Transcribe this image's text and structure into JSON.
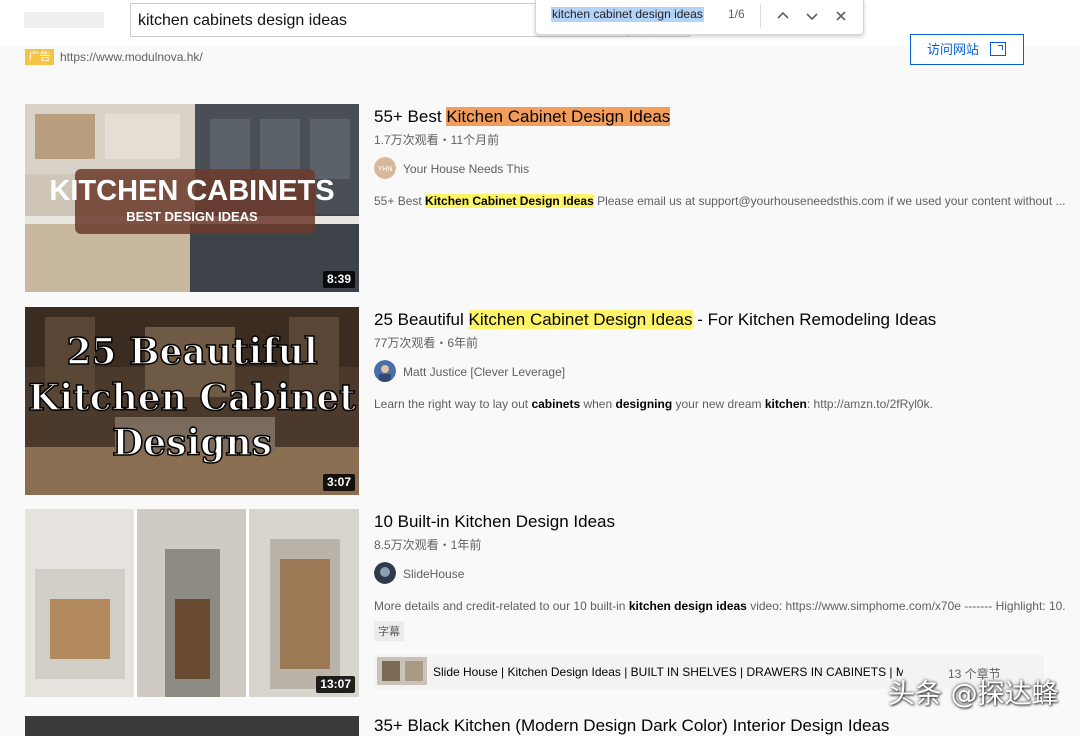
{
  "search": {
    "query": "kitchen cabinets design ideas"
  },
  "find_bar": {
    "query": "kitchen cabinet design ideas",
    "count": "1/6",
    "icons": [
      "chevron-up-icon",
      "chevron-down-icon",
      "close-icon"
    ]
  },
  "ad": {
    "badge": "广告",
    "url": "https://www.modulnova.hk/",
    "visit_label": "访问网站"
  },
  "videos": [
    {
      "title_prefix": "55+ Best ",
      "title_highlight": "Kitchen Cabinet Design Ideas",
      "title_suffix": "",
      "meta": "1.7万次观看・11个月前",
      "channel": "Your House Needs This",
      "avatar_text": "YHN",
      "desc_prefix": "55+ Best ",
      "desc_highlight": "Kitchen Cabinet Design Ideas",
      "desc_suffix": " Please email us at support@yourhouseneedsthis.com if we used your content without ...",
      "thumb_line1": "KITCHEN CABINETS",
      "thumb_line2": "BEST DESIGN IDEAS",
      "duration": "8:39"
    },
    {
      "title_prefix": "25 Beautiful ",
      "title_highlight": "Kitchen Cabinet Design Ideas",
      "title_suffix": " - For Kitchen Remodeling Ideas",
      "meta": "77万次观看・6年前",
      "channel": "Matt Justice [Clever Leverage]",
      "desc_parts": [
        "Learn the right way to lay out ",
        "cabinets",
        " when ",
        "designing",
        " your new dream ",
        "kitchen",
        ": http://amzn.to/2fRyl0k."
      ],
      "thumb_line1": "25 Beautiful",
      "thumb_line2": "Kitchen Cabinet",
      "thumb_line3": "Designs",
      "duration": "3:07"
    },
    {
      "title": "10 Built-in Kitchen Design Ideas",
      "meta": "8.5万次观看・1年前",
      "channel": "SlideHouse",
      "desc_parts": [
        "More details and credit-related to our 10 built-in ",
        "kitchen design ideas",
        " video: https://www.simphome.com/x70e ------- Highlight: 10."
      ],
      "badge": "字幕",
      "chapter_text": "Slide House | Kitchen Design Ideas | BUILT IN SHELVES | DRAWERS IN CABINETS | MAKE YOUR",
      "chapter_count": "13 个章节",
      "duration": "13:07"
    },
    {
      "title": "35+ Black Kitchen (Modern Design Dark Color) Interior Design Ideas"
    }
  ],
  "watermark": "头条 @探达蜂",
  "colors": {
    "highlight_active": "#f29d5c",
    "highlight": "#fef467",
    "link_blue": "#065fd4",
    "ad_badge": "#f5c445"
  }
}
